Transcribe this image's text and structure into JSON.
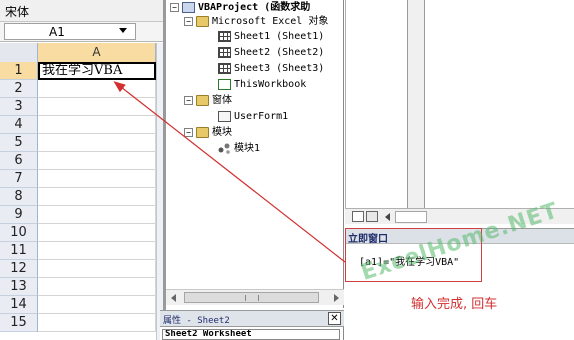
{
  "excel": {
    "font_name": "宋体",
    "name_box": "A1",
    "column_header": "A",
    "rows": [
      {
        "num": "1",
        "value": "我在学习VBA"
      },
      {
        "num": "2",
        "value": ""
      },
      {
        "num": "3",
        "value": ""
      },
      {
        "num": "4",
        "value": ""
      },
      {
        "num": "5",
        "value": ""
      },
      {
        "num": "6",
        "value": ""
      },
      {
        "num": "7",
        "value": ""
      },
      {
        "num": "8",
        "value": ""
      },
      {
        "num": "9",
        "value": ""
      },
      {
        "num": "10",
        "value": ""
      },
      {
        "num": "11",
        "value": ""
      },
      {
        "num": "12",
        "value": ""
      },
      {
        "num": "13",
        "value": ""
      },
      {
        "num": "14",
        "value": ""
      },
      {
        "num": "15",
        "value": ""
      }
    ]
  },
  "project_tree": {
    "root": "VBAProject (函数求助",
    "excel_objects_folder": "Microsoft Excel 对象",
    "sheets": [
      "Sheet1 (Sheet1)",
      "Sheet2 (Sheet2)",
      "Sheet3 (Sheet3)"
    ],
    "workbook": "ThisWorkbook",
    "forms_folder": "窗体",
    "form": "UserForm1",
    "modules_folder": "模块",
    "module": "模块1"
  },
  "properties": {
    "title": "属性 - Sheet2",
    "close_glyph": "✕",
    "dropdown_value": "Sheet2 Worksheet"
  },
  "immediate": {
    "title": "立即窗口",
    "code": "[a1]=\"我在学习VBA\""
  },
  "annotation": {
    "text": "输入完成, 回车",
    "color": "#d23030"
  },
  "watermark": "ExcelHome.NET",
  "colors": {
    "active_header": "#f9dca2",
    "header_bg": "#e9edf3",
    "annotation_red": "#d23030"
  }
}
